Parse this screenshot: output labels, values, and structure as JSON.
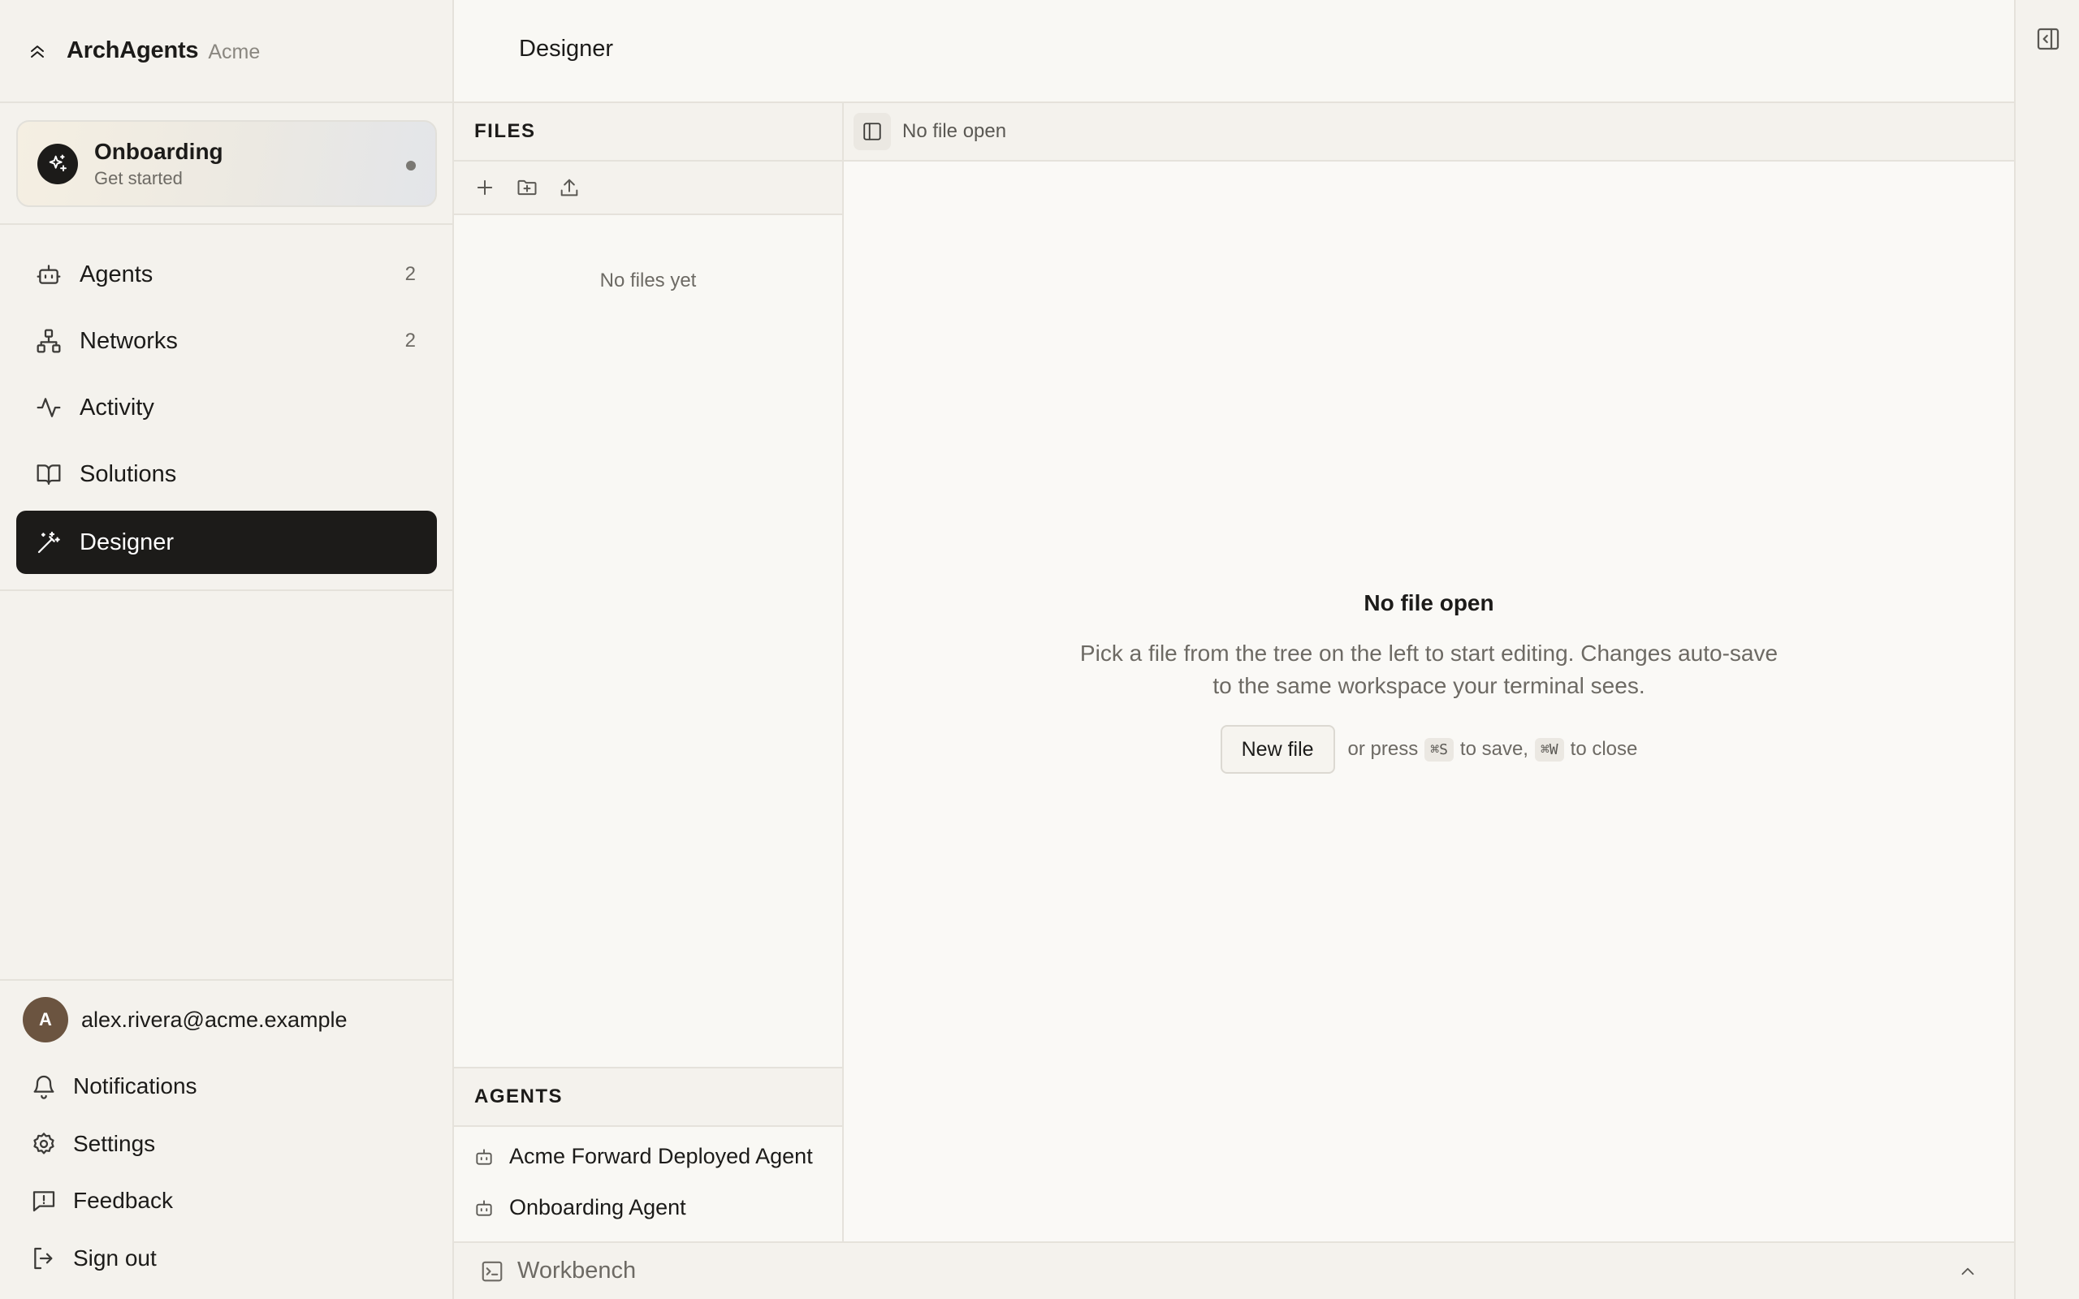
{
  "brand": {
    "name": "ArchAgents",
    "org": "Acme"
  },
  "onboarding": {
    "title": "Onboarding",
    "subtitle": "Get started"
  },
  "nav": {
    "items": [
      {
        "label": "Agents",
        "count": "2",
        "icon": "bot-icon"
      },
      {
        "label": "Networks",
        "count": "2",
        "icon": "network-icon"
      },
      {
        "label": "Activity",
        "icon": "activity-icon"
      },
      {
        "label": "Solutions",
        "icon": "book-icon"
      },
      {
        "label": "Designer",
        "icon": "wand-icon",
        "active": true
      }
    ]
  },
  "user": {
    "initial": "A",
    "email": "alex.rivera@acme.example"
  },
  "bottom_nav": {
    "notifications": "Notifications",
    "settings": "Settings",
    "feedback": "Feedback",
    "sign_out": "Sign out"
  },
  "header": {
    "title": "Designer"
  },
  "files_panel": {
    "heading": "FILES",
    "empty_text": "No files yet",
    "tools": [
      "plus-icon",
      "folder-plus-icon",
      "upload-icon"
    ]
  },
  "agents_panel": {
    "heading": "AGENTS",
    "items": [
      "Acme Forward Deployed Agent",
      "Onboarding Agent"
    ]
  },
  "editor": {
    "tab_label": "No file open",
    "empty_title": "No file open",
    "empty_line1": "Pick a file from the tree on the left to start editing. Changes auto-save",
    "empty_line2": "to the same workspace your terminal sees.",
    "new_file_button": "New file",
    "hint_prefix": "or press",
    "save_key": "⌘S",
    "hint_middle": "to save,",
    "close_key": "⌘W",
    "hint_suffix": "to close"
  },
  "workbench": {
    "label": "Workbench"
  },
  "colors": {
    "accent": "#1c1b19",
    "background": "#f6f4ef",
    "border": "#e5e2db",
    "muted_text": "#6d6a64",
    "avatar": "#6b5440"
  }
}
